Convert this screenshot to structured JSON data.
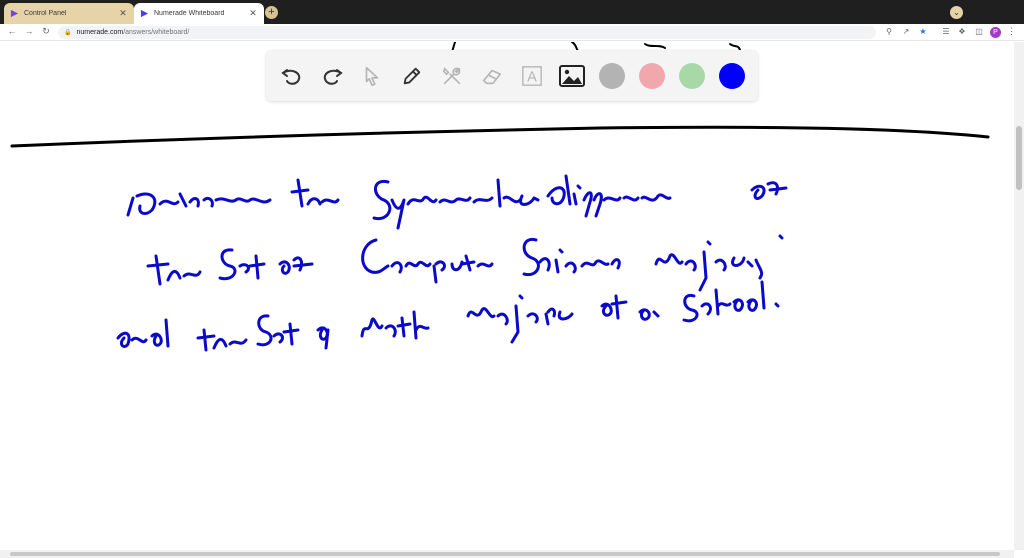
{
  "browser": {
    "tabs": [
      {
        "title": "Control Panel",
        "icon": "numerade-logo-icon",
        "active": false
      },
      {
        "title": "Numerade Whiteboard",
        "icon": "numerade-logo-icon",
        "active": true
      }
    ],
    "new_tab_glyph": "+",
    "close_glyph": "✕",
    "url_host": "numerade.com",
    "url_path": "/answers/whiteboard/",
    "profile_initial": "P"
  },
  "whiteboard_toolbar": {
    "tools": [
      "undo-icon",
      "redo-icon",
      "pointer-icon",
      "pen-icon",
      "tools-icon",
      "eraser-icon",
      "text-icon",
      "image-icon"
    ],
    "text_tool_label": "A",
    "colors": [
      "#b3b3b3",
      "#f0a8ad",
      "#a8d8a8",
      "#0000ff"
    ],
    "selected_color": "#0000ff"
  },
  "canvas": {
    "ink_color": "#0a0ac8",
    "note_lines": [
      "Determine the Symmetric difference of",
      "the Set of Computer Science majors.",
      "and the Set of Math majors at a school."
    ]
  }
}
